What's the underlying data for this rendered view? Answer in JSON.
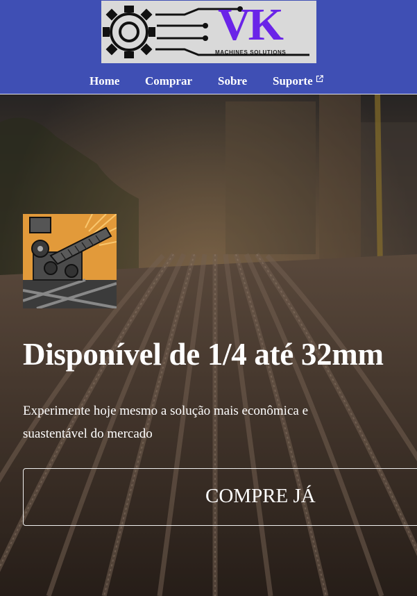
{
  "header": {
    "logo": {
      "brand": "VK",
      "tagline": "MACHINES SOLUTIONS",
      "icon": "gear-circuit-icon",
      "brand_color": "#6a24e8"
    },
    "bg_color": "#3f4fb4",
    "nav": [
      {
        "label": "Home"
      },
      {
        "label": "Comprar"
      },
      {
        "label": "Sobre"
      },
      {
        "label": "Suporte",
        "icon": "external-link-icon"
      }
    ]
  },
  "hero": {
    "image_icon": "machine-illustration",
    "title": "Disponível de 1/4 até 32mm",
    "subtitle": "Experimente hoje mesmo a solução mais econômica e suastentável do mercado",
    "cta_label": "COMPRE JÁ"
  }
}
